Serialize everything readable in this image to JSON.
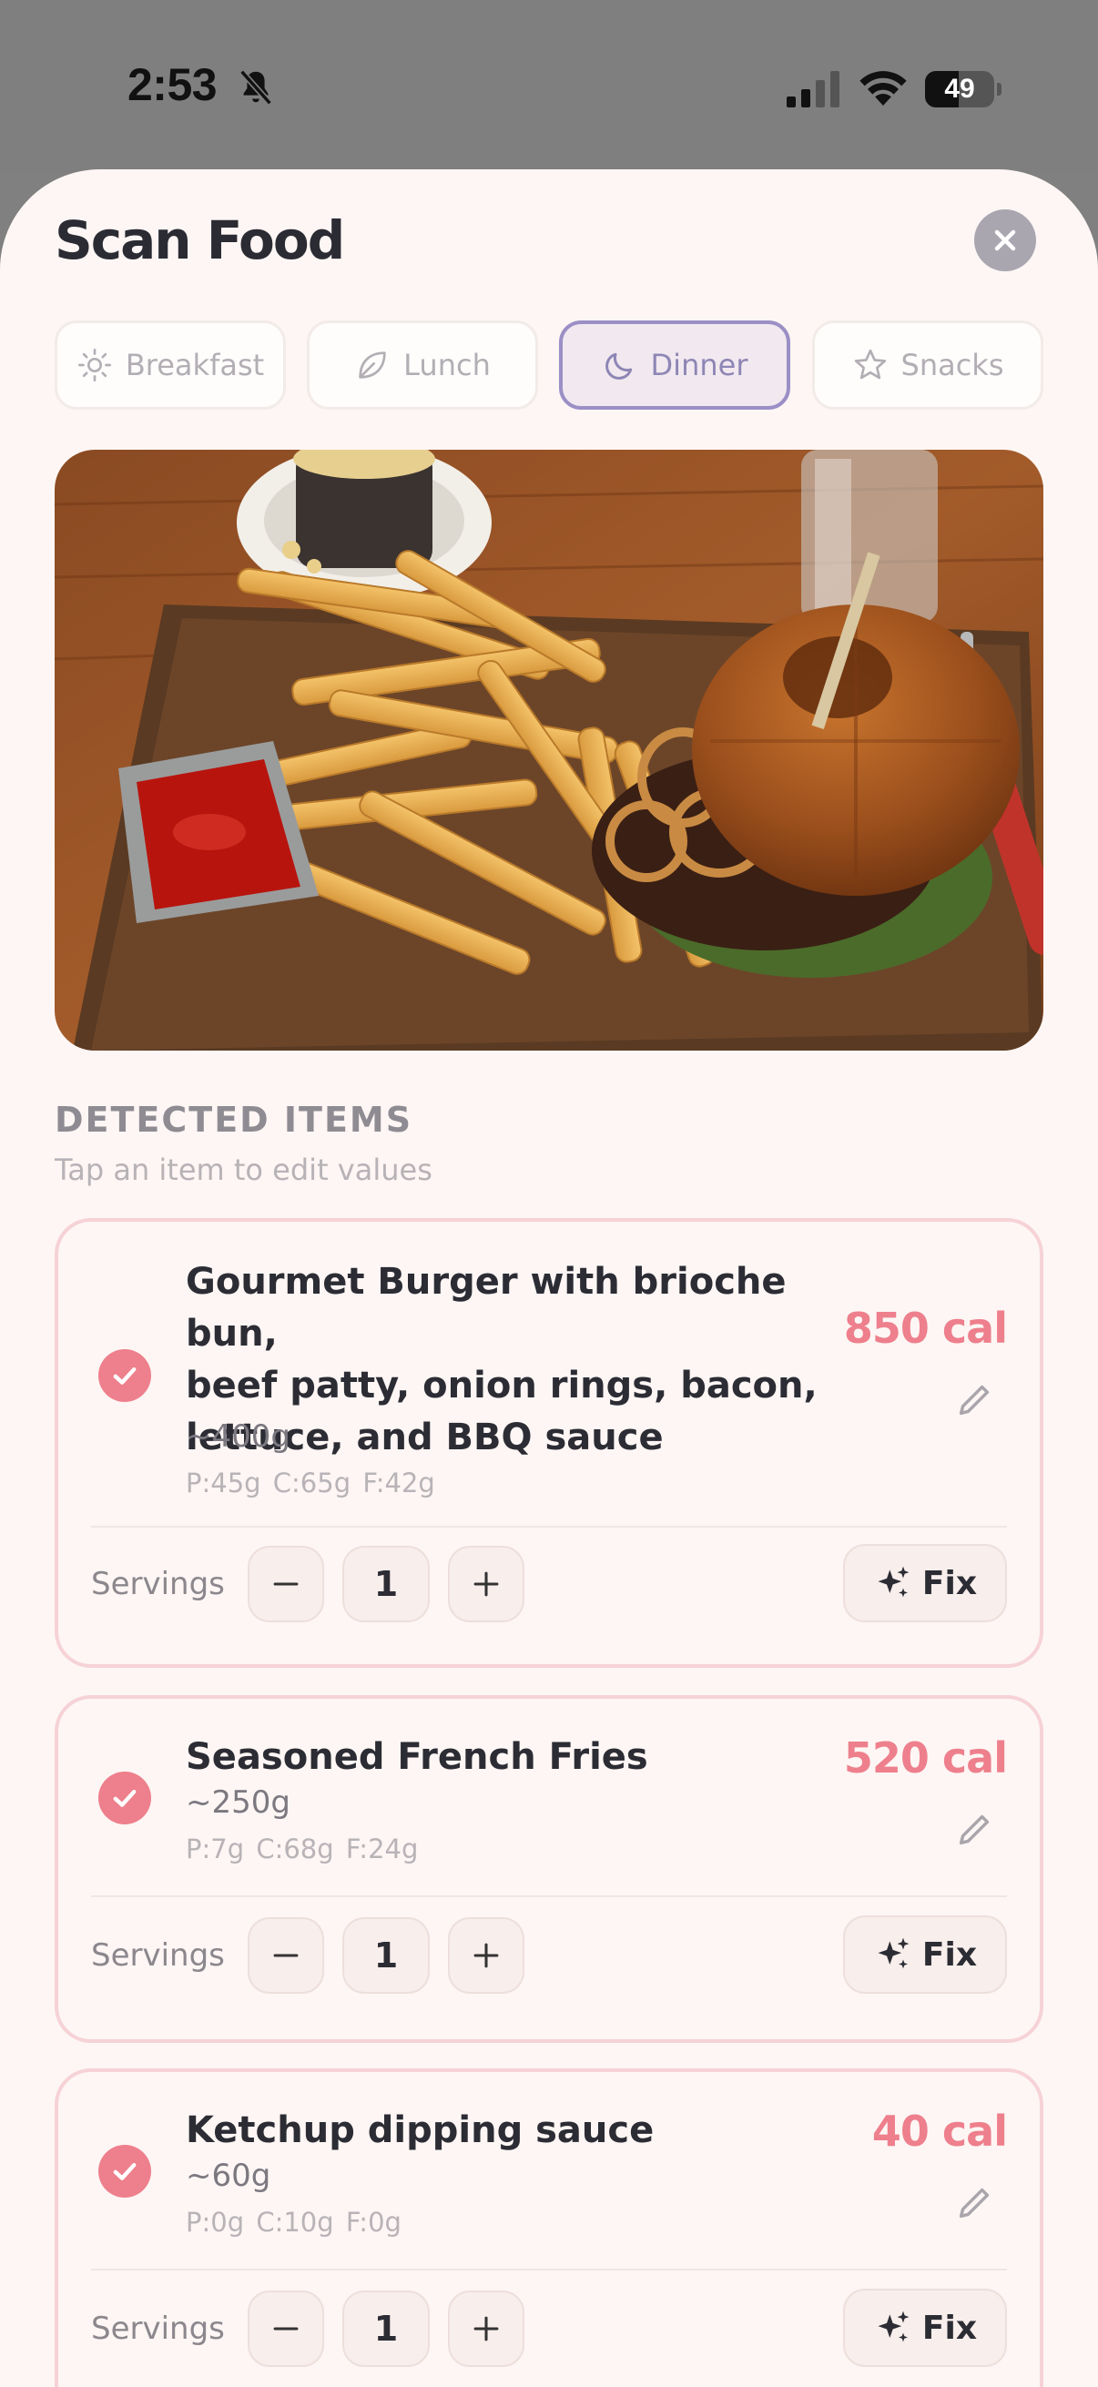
{
  "status_bar": {
    "time": "2:53",
    "battery_level": "49",
    "icons": [
      "bell-slash-icon",
      "cellular-signal-icon",
      "wifi-icon",
      "battery-icon"
    ]
  },
  "header": {
    "title": "Scan Food",
    "close_icon": "close-icon"
  },
  "meal_tabs": [
    {
      "label": "Breakfast",
      "icon": "sun-icon",
      "selected": false
    },
    {
      "label": "Lunch",
      "icon": "leaf-icon",
      "selected": false
    },
    {
      "label": "Dinner",
      "icon": "moon-icon",
      "selected": true
    },
    {
      "label": "Snacks",
      "icon": "star-icon",
      "selected": false
    }
  ],
  "photo": {
    "subject": "burger-with-fries-and-ketchup-photo"
  },
  "detected": {
    "title": "DETECTED ITEMS",
    "subtitle": "Tap an item to edit values"
  },
  "items": [
    {
      "name_lines": [
        "Gourmet Burger with brioche bun,",
        "beef patty, onion rings, bacon,",
        "lettuce, and BBQ sauce"
      ],
      "weight": "~400g",
      "macros": "P:45g  C:65g  F:42g",
      "calories": "850 cal",
      "servings_label": "Servings",
      "servings": "1",
      "fix_label": "Fix"
    },
    {
      "name_lines": [
        "Seasoned French Fries"
      ],
      "weight": "~250g",
      "macros": "P:7g  C:68g  F:24g",
      "calories": "520 cal",
      "servings_label": "Servings",
      "servings": "1",
      "fix_label": "Fix"
    },
    {
      "name_lines": [
        "Ketchup dipping sauce"
      ],
      "weight": "~60g",
      "macros": "P:0g  C:10g  F:0g",
      "calories": "40 cal",
      "servings_label": "Servings",
      "servings": "1",
      "fix_label": "Fix"
    }
  ],
  "colors": {
    "accent": "#ee7f8c",
    "selected_tab_border": "#9b8fc6",
    "sheet_background": "#fdf6f4"
  }
}
